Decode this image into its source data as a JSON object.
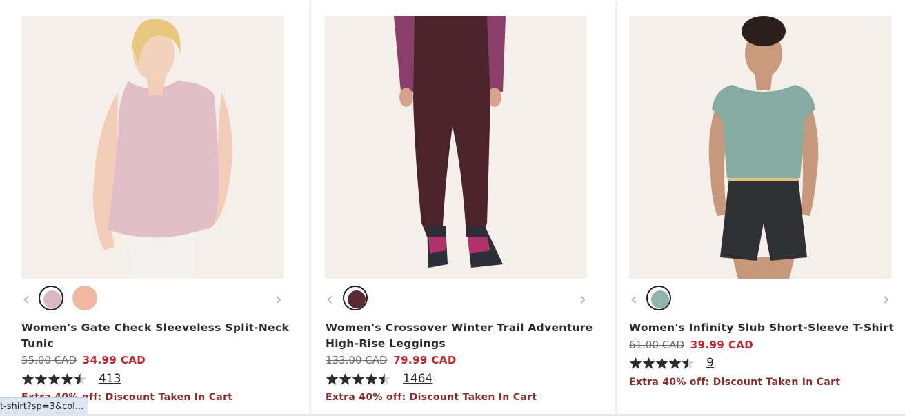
{
  "products": [
    {
      "name": "Women's Gate Check Sleeveless Split-Neck Tunic",
      "old_price": "55.00 CAD",
      "price": "34.99 CAD",
      "rating_count": "413",
      "rating": 4.5,
      "promo": "Extra 40% off: Discount Taken In Cart",
      "swatches": [
        "#d9b8c4",
        "#f2b9a0"
      ]
    },
    {
      "name": "Women's Crossover Winter Trail Adventure High-Rise Leggings",
      "old_price": "133.00 CAD",
      "price": "79.99 CAD",
      "rating_count": "1464",
      "rating": 4.5,
      "promo": "Extra 40% off: Discount Taken In Cart",
      "swatches": [
        "#5a2a33"
      ]
    },
    {
      "name": "Women's Infinity Slub Short-Sleeve T-Shirt",
      "old_price": "61.00 CAD",
      "price": "39.99 CAD",
      "rating_count": "9",
      "rating": 4.5,
      "promo": "Extra 40% off: Discount Taken In Cart",
      "swatches": [
        "#8fb3ad"
      ]
    }
  ],
  "nav": {
    "prev": "‹",
    "next": "›"
  },
  "status_url": "t-shirt?sp=3&col...",
  "colors": {
    "sale": "#c0262d",
    "promo": "#8c2b2b",
    "image_bg": "#f5efe9"
  }
}
